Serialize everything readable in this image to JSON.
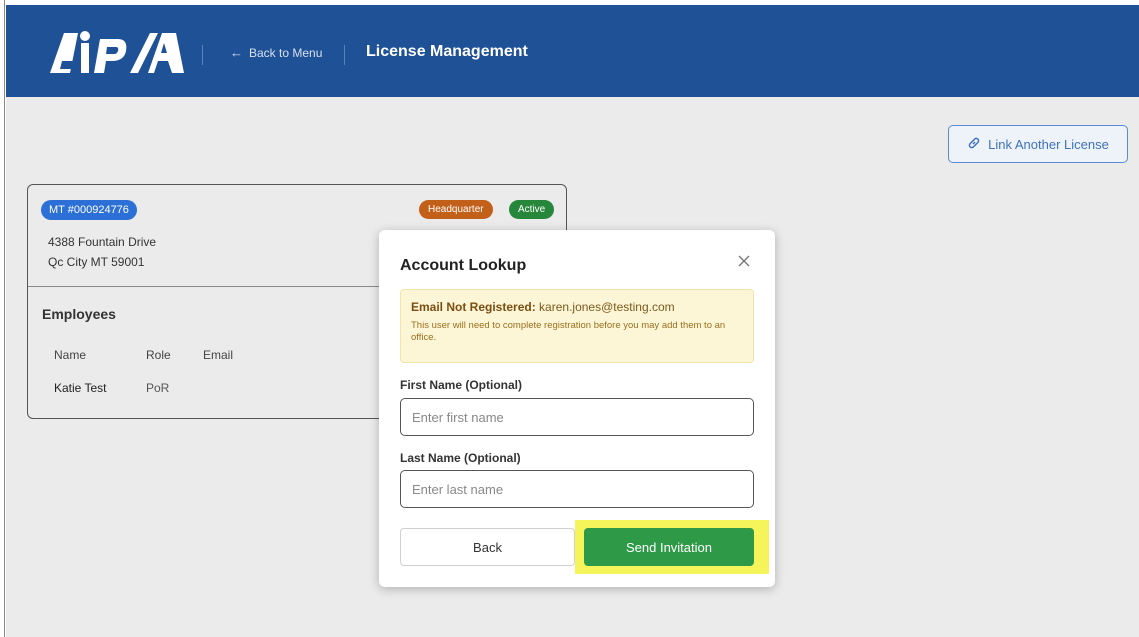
{
  "header": {
    "logo_text": "AiPSA",
    "back_label": "Back to Menu",
    "title": "License Management"
  },
  "toolbar": {
    "link_license_label": "Link Another License"
  },
  "license": {
    "number": "MT #000924776",
    "hq_badge": "Headquarter",
    "status_badge": "Active",
    "address_line1": "4388 Fountain Drive",
    "address_line2": "Qc City MT 59001",
    "employees_title": "Employees",
    "columns": [
      "Name",
      "Role",
      "Email"
    ],
    "rows": [
      {
        "name": "Katie Test",
        "role": "PoR"
      }
    ]
  },
  "modal": {
    "title": "Account Lookup",
    "alert_label": "Email Not Registered:",
    "alert_email": "karen.jones@testing.com",
    "alert_body": "This user will need to complete registration before you may add them to an office.",
    "first_name_label": "First Name (Optional)",
    "first_name_placeholder": "Enter first name",
    "last_name_label": "Last Name (Optional)",
    "last_name_placeholder": "Enter last name",
    "back_label": "Back",
    "send_label": "Send Invitation"
  },
  "colors": {
    "header_bg": "#1f5196",
    "primary_badge": "#2c6fd6",
    "hq_badge": "#c25f18",
    "active_badge": "#26863a",
    "send_button": "#2e9a47",
    "highlight": "#f5f45a"
  }
}
